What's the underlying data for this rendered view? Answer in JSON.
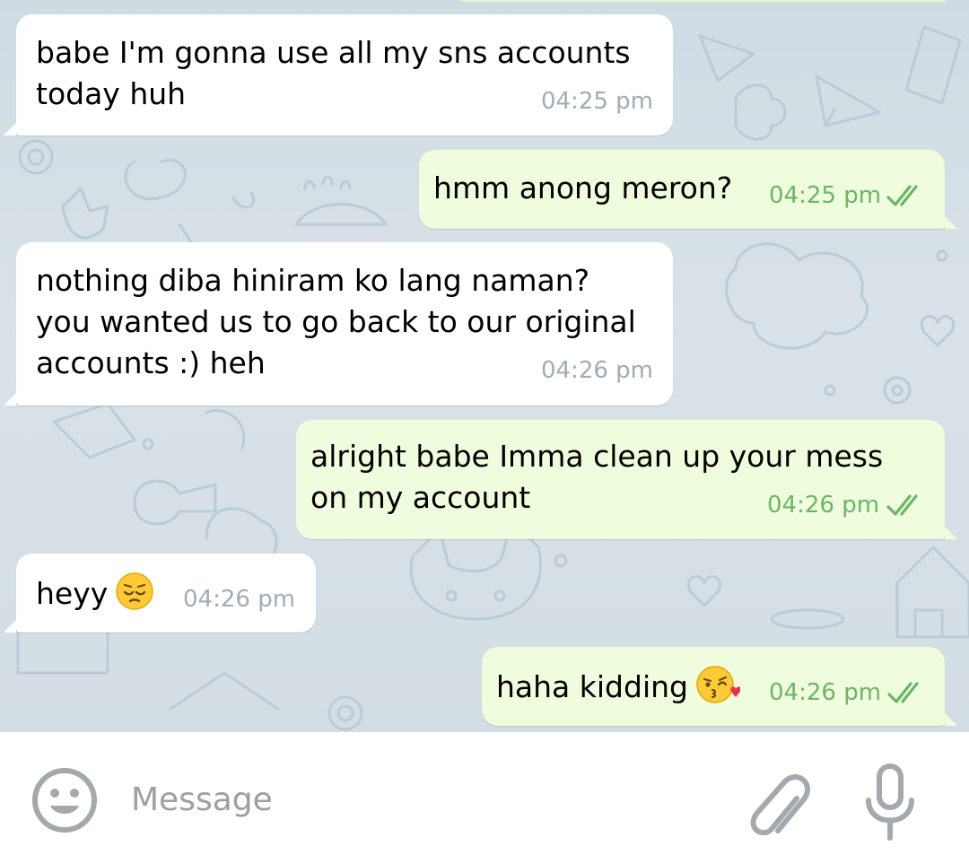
{
  "messages": [
    {
      "direction": "in",
      "lines": [
        "babe I'm gonna use all my sns accounts",
        "today huh"
      ],
      "time": "04:25 pm"
    },
    {
      "direction": "out",
      "lines": [
        "hmm anong meron?"
      ],
      "time": "04:25 pm",
      "read": true
    },
    {
      "direction": "in",
      "lines": [
        "nothing diba hiniram ko lang naman?",
        "you wanted us to go back to our original",
        "accounts :) heh"
      ],
      "time": "04:26 pm"
    },
    {
      "direction": "out",
      "lines": [
        "alright babe Imma clean up your mess",
        "on my account"
      ],
      "time": "04:26 pm",
      "read": true
    },
    {
      "direction": "in",
      "lines": [
        "heyy"
      ],
      "emoji": "pensive-face-emoji",
      "time": "04:26 pm"
    },
    {
      "direction": "out",
      "lines": [
        "haha kidding"
      ],
      "emoji": "kissing-face-emoji",
      "time": "04:26 pm",
      "read": true
    }
  ],
  "input_bar": {
    "placeholder": "Message",
    "value": ""
  },
  "icons": {
    "emoji_button": "smiley-icon",
    "attach_button": "paperclip-icon",
    "mic_button": "microphone-icon",
    "read_receipt": "double-check-icon"
  },
  "colors": {
    "incoming_bubble": "#ffffff",
    "outgoing_bubble": "#effdde",
    "outgoing_time": "#6db564",
    "incoming_time": "#a0acb6",
    "chat_background": "#d5dfe6",
    "input_icons": "#a4a9ad"
  }
}
